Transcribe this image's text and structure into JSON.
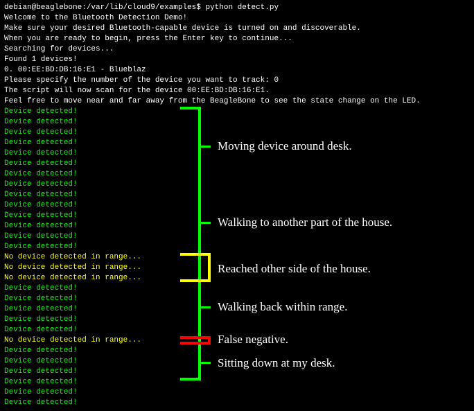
{
  "prompt": {
    "user_host_path": "debian@beaglebone:/var/lib/cloud9/examples$",
    "command": "python detect.py"
  },
  "intro": [
    "Welcome to the Bluetooth Detection Demo!",
    "Make sure your desired Bluetooth-capable device is turned on and discoverable.",
    "When you are ready to begin, press the Enter key to continue...",
    "Searching for devices...",
    "Found 1 devices!",
    "0. 00:EE:BD:DB:16:E1 - Blueblaz",
    "Please specify the number of the device you want to track: 0",
    "The script will now scan for the device 00:EE:BD:DB:16:E1.",
    "Feel free to move near and far away from the BeagleBone to see the state change on the LED."
  ],
  "log": [
    {
      "text": "Device detected!",
      "cls": "green"
    },
    {
      "text": "Device detected!",
      "cls": "green"
    },
    {
      "text": "Device detected!",
      "cls": "green"
    },
    {
      "text": "Device detected!",
      "cls": "green"
    },
    {
      "text": "Device detected!",
      "cls": "green"
    },
    {
      "text": "Device detected!",
      "cls": "green"
    },
    {
      "text": "Device detected!",
      "cls": "green"
    },
    {
      "text": "Device detected!",
      "cls": "green"
    },
    {
      "text": "Device detected!",
      "cls": "green"
    },
    {
      "text": "Device detected!",
      "cls": "green"
    },
    {
      "text": "Device detected!",
      "cls": "green"
    },
    {
      "text": "Device detected!",
      "cls": "green"
    },
    {
      "text": "Device detected!",
      "cls": "green"
    },
    {
      "text": "Device detected!",
      "cls": "green"
    },
    {
      "text": "No device detected in range...",
      "cls": "yellow"
    },
    {
      "text": "No device detected in range...",
      "cls": "yellow"
    },
    {
      "text": "No device detected in range...",
      "cls": "yellow"
    },
    {
      "text": "Device detected!",
      "cls": "green"
    },
    {
      "text": "Device detected!",
      "cls": "green"
    },
    {
      "text": "Device detected!",
      "cls": "green"
    },
    {
      "text": "Device detected!",
      "cls": "green"
    },
    {
      "text": "Device detected!",
      "cls": "green"
    },
    {
      "text": "No device detected in range...",
      "cls": "yellow"
    },
    {
      "text": "Device detected!",
      "cls": "green"
    },
    {
      "text": "Device detected!",
      "cls": "green"
    },
    {
      "text": "Device detected!",
      "cls": "green"
    },
    {
      "text": "Device detected!",
      "cls": "green"
    },
    {
      "text": "Device detected!",
      "cls": "green"
    },
    {
      "text": "Device detected!",
      "cls": "green"
    }
  ],
  "annotations": [
    {
      "label": "Moving device around desk."
    },
    {
      "label": "Walking to another part of the house."
    },
    {
      "label": "Reached other side of the house."
    },
    {
      "label": "Walking back within range."
    },
    {
      "label": "False negative."
    },
    {
      "label": "Sitting down at my desk."
    }
  ]
}
